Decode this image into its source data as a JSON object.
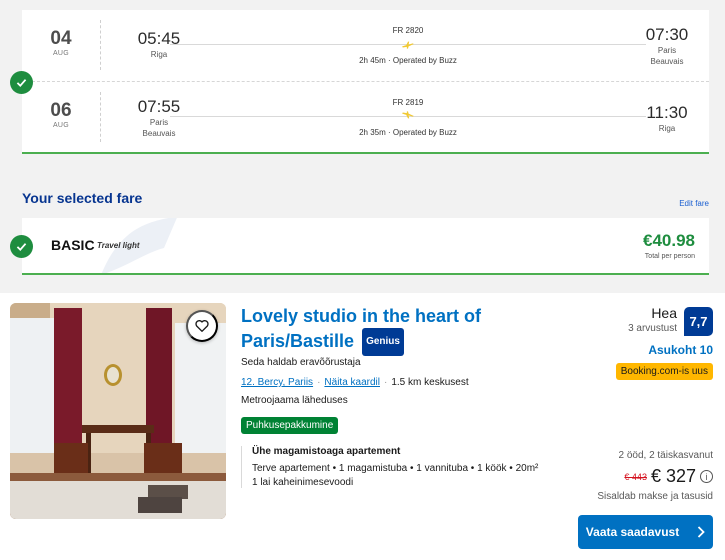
{
  "flights": [
    {
      "day": "04",
      "month": "AUG",
      "dep_time": "05:45",
      "dep_city": "Riga",
      "dep_airport": "",
      "flight_no": "FR 2820",
      "duration": "2h 45m · Operated by Buzz",
      "arr_time": "07:30",
      "arr_city": "Paris",
      "arr_airport": "Beauvais"
    },
    {
      "day": "06",
      "month": "AUG",
      "dep_time": "07:55",
      "dep_city": "Paris",
      "dep_airport": "Beauvais",
      "flight_no": "FR 2819",
      "duration": "2h 35m · Operated by Buzz",
      "arr_time": "11:30",
      "arr_city": "Riga",
      "arr_airport": ""
    }
  ],
  "fare": {
    "heading": "Your selected fare",
    "edit_link": "Edit fare",
    "name": "BASIC",
    "subtitle": "Travel light",
    "price": "€40.98",
    "price_note": "Total per person"
  },
  "hotel": {
    "title": "Lovely studio in the heart of Paris/Bastille",
    "genius": "Genius",
    "managed": "Seda haldab eravõõrustaja",
    "district": "12. Bercy, Pariis",
    "map_link": "Näita kaardil",
    "distance": "1.5 km keskusest",
    "metro": "Metroojaama läheduses",
    "vacation_badge": "Puhkusepakkumine",
    "room_name": "Ühe magamistoaga apartement",
    "room_desc": "Terve apartement • 1 magamistuba • 1 vannituba • 1 köök • 20m²",
    "bed": "1 lai kaheinimesevoodi",
    "review_word": "Hea",
    "review_count": "3 arvustust",
    "score": "7,7",
    "location_score": "Asukoht 10",
    "new_badge": "Booking.com-is uus",
    "nights": "2 ööd, 2 täiskasvanut",
    "old_price": "€ 443",
    "new_price": "€ 327",
    "taxes": "Sisaldab makse ja tasusid",
    "cta": "Vaata saadavust"
  },
  "colors": {
    "ryanair_blue": "#073590",
    "check_green": "#1e8d3f",
    "booking_blue": "#0071c2",
    "booking_dark": "#003b95",
    "badge_yellow": "#ffb700",
    "badge_green": "#008234"
  },
  "icons": [
    "check-icon",
    "plane-icon",
    "heart-icon",
    "info-icon",
    "chevron-right-icon"
  ]
}
